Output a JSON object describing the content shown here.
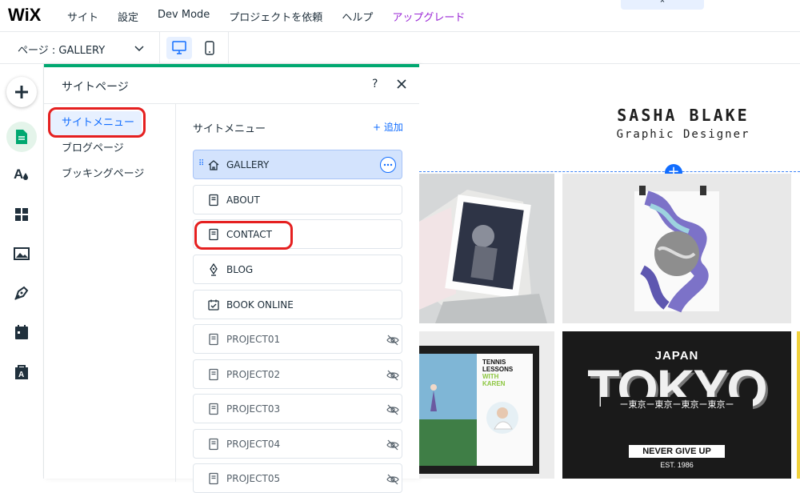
{
  "topbar": {
    "logo": "WiX",
    "menu": [
      "サイト",
      "設定",
      "Dev Mode",
      "プロジェクトを依頼",
      "ヘルプ"
    ],
    "upgrade": "アップグレード",
    "collapse_icon": "chevron-up-icon",
    "collapse_glyph": "⌃"
  },
  "pagebar": {
    "page_label": "ページ : GALLERY",
    "devices": [
      "desktop-icon",
      "mobile-icon"
    ]
  },
  "leftbar": {
    "items": [
      "add-icon",
      "pages-icon",
      "theme-icon",
      "apps-icon",
      "media-icon",
      "blog-pen-icon",
      "bookings-calendar-icon",
      "app-market-icon"
    ]
  },
  "panel": {
    "title": "サイトページ",
    "help": "?",
    "categories": [
      {
        "label": "サイトメニュー",
        "active": true
      },
      {
        "label": "ブログページ",
        "active": false
      },
      {
        "label": "ブッキングページ",
        "active": false
      }
    ],
    "list_title": "サイトメニュー",
    "add_label": "+ 追加",
    "pages": [
      {
        "name": "GALLERY",
        "icon": "home-icon",
        "selected": true,
        "hidden": false
      },
      {
        "name": "ABOUT",
        "icon": "page-icon",
        "selected": false,
        "hidden": false
      },
      {
        "name": "CONTACT",
        "icon": "page-icon",
        "selected": false,
        "hidden": false
      },
      {
        "name": "BLOG",
        "icon": "pen-icon",
        "selected": false,
        "hidden": false
      },
      {
        "name": "BOOK ONLINE",
        "icon": "calendar-icon",
        "selected": false,
        "hidden": false
      },
      {
        "name": "PROJECT01",
        "icon": "page-icon",
        "selected": false,
        "hidden": true
      },
      {
        "name": "PROJECT02",
        "icon": "page-icon",
        "selected": false,
        "hidden": true
      },
      {
        "name": "PROJECT03",
        "icon": "page-icon",
        "selected": false,
        "hidden": true
      },
      {
        "name": "PROJECT04",
        "icon": "page-icon",
        "selected": false,
        "hidden": true
      },
      {
        "name": "PROJECT05",
        "icon": "page-icon",
        "selected": false,
        "hidden": true
      }
    ]
  },
  "canvas": {
    "site_name": "SASHA BLAKE",
    "site_role": "Graphic Designer",
    "add_section": "+",
    "tennis": {
      "title1": "TENNIS",
      "title2": "LESSONS",
      "with1": "WITH",
      "with2": "KAREN"
    },
    "tokyo": {
      "japan": "JAPAN",
      "tokyo": "TOKYO",
      "kanji": "ー東京ー東京ー東京ー東京ー",
      "slogan": "NEVER GIVE UP",
      "est": "EST. 1986"
    }
  },
  "colors": {
    "accent": "#116dff",
    "green": "#00a870",
    "upgrade": "#9a27d5",
    "highlight": "#e52020"
  }
}
